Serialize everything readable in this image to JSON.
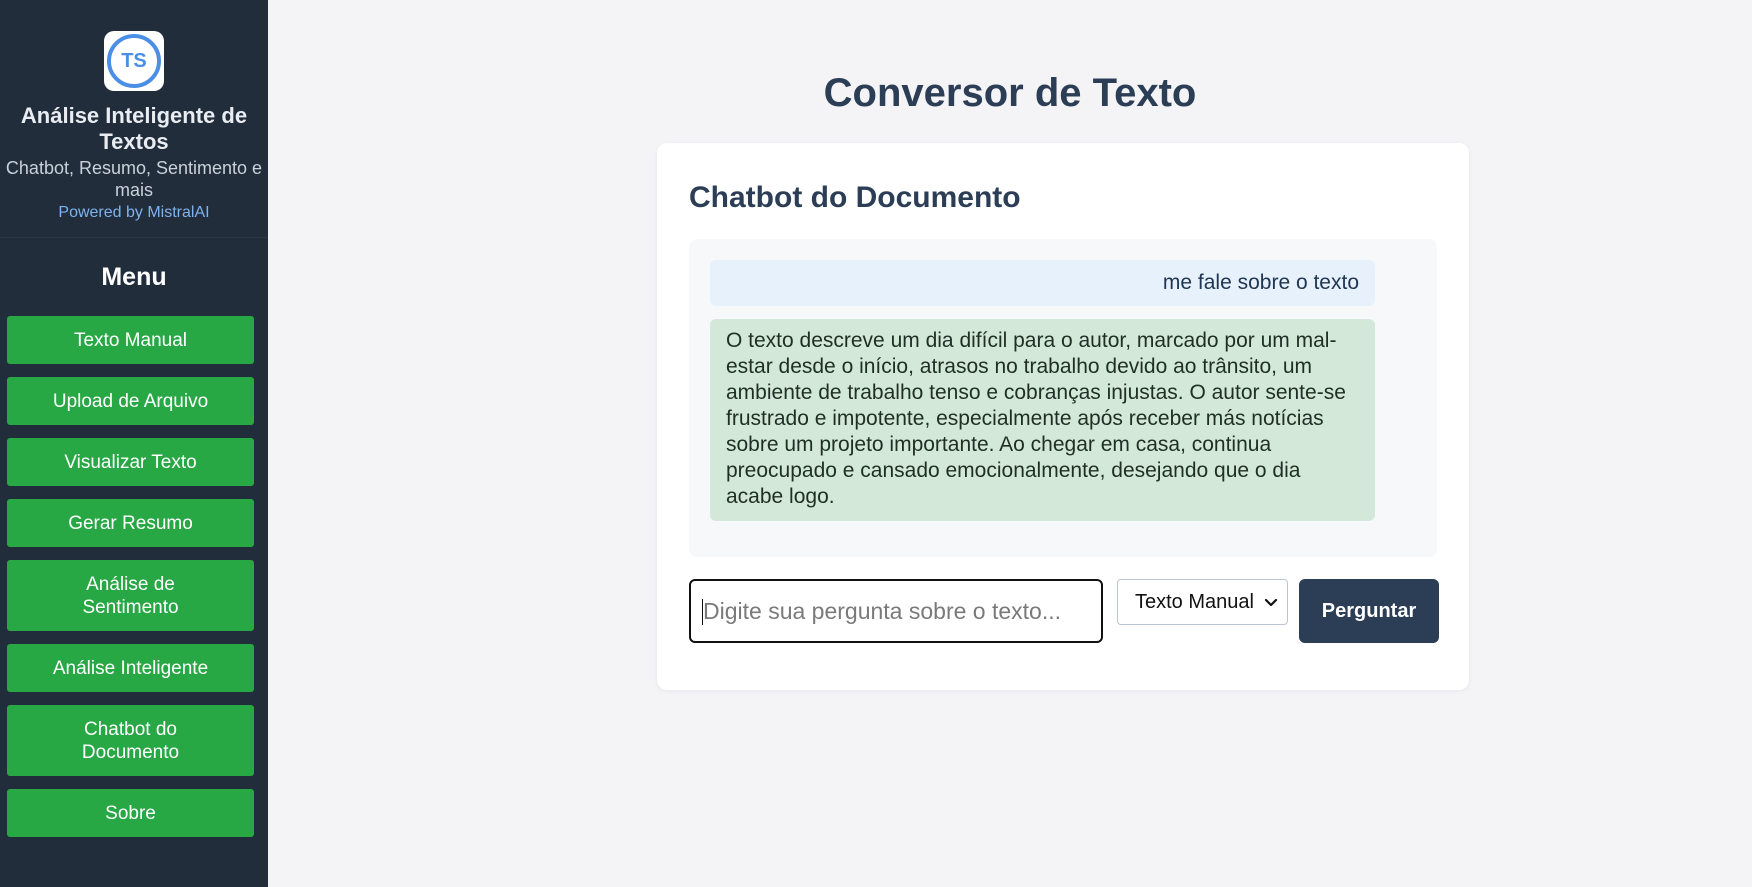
{
  "sidebar": {
    "logo_text": "TS",
    "title": "Análise Inteligente de Textos",
    "subtitle": "Chatbot, Resumo, Sentimento e mais",
    "powered": "Powered by MistralAI",
    "menu_title": "Menu",
    "items": [
      {
        "label": "Texto Manual"
      },
      {
        "label": "Upload de Arquivo"
      },
      {
        "label": "Visualizar Texto"
      },
      {
        "label": "Gerar Resumo"
      },
      {
        "label": "Análise de Sentimento"
      },
      {
        "label": "Análise Inteligente"
      },
      {
        "label": "Chatbot do Documento"
      },
      {
        "label": "Sobre"
      }
    ]
  },
  "main": {
    "page_title": "Conversor de Texto",
    "card_title": "Chatbot do Documento",
    "messages": {
      "user": "me fale sobre o texto",
      "bot": "O texto descreve um dia difícil para o autor, marcado por um mal-estar desde o início, atrasos no trabalho devido ao trânsito, um ambiente de trabalho tenso e cobranças injustas. O autor sente-se frustrado e impotente, especialmente após receber más notícias sobre um projeto importante. Ao chegar em casa, continua preocupado e cansado emocionalmente, desejando que o dia acabe logo."
    },
    "input": {
      "value": "",
      "placeholder": "Digite sua pergunta sobre o texto..."
    },
    "source_select": {
      "selected": "Texto Manual"
    },
    "ask_button": "Perguntar"
  },
  "colors": {
    "sidebar_bg": "#212d3b",
    "menu_button": "#28a745",
    "accent_dark": "#2c3e56",
    "user_bubble": "#e7f1fc",
    "bot_bubble": "#d4e8da",
    "logo_ring": "#4a8ee6"
  },
  "icons": {
    "logo": "ts-logo-icon",
    "select_arrow": "chevron-down-icon"
  }
}
